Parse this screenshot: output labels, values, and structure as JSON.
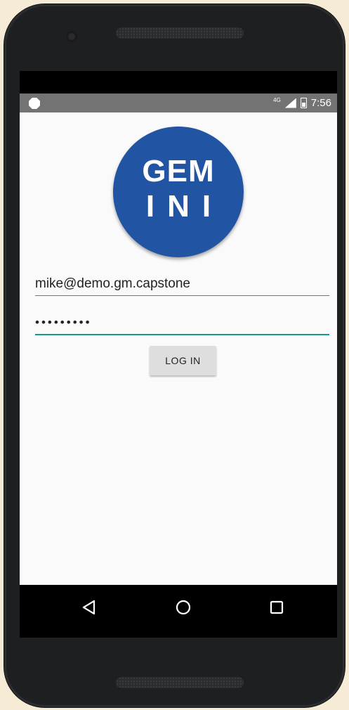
{
  "status_bar": {
    "network": "4G",
    "time": "7:56"
  },
  "logo": {
    "line1": "GEM",
    "line2": "INI",
    "color": "#2254a4"
  },
  "form": {
    "email_value": "mike@demo.gm.capstone",
    "password_value": "•••••••••",
    "login_label": "LOG IN",
    "accent_color": "#159b8e"
  },
  "nav_bar": {
    "icons": [
      "back-icon",
      "home-icon",
      "recents-icon"
    ]
  }
}
